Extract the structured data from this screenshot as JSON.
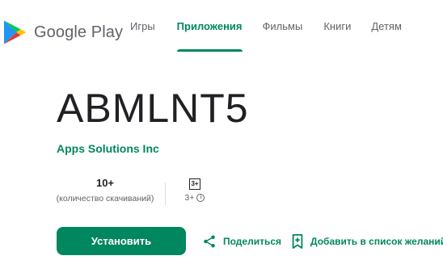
{
  "header": {
    "logo_text": "Google Play",
    "nav": [
      {
        "label": "Игры",
        "active": false
      },
      {
        "label": "Приложения",
        "active": true
      },
      {
        "label": "Фильмы",
        "active": false
      },
      {
        "label": "Книги",
        "active": false
      },
      {
        "label": "Детям",
        "active": false
      }
    ]
  },
  "app": {
    "title": "ABMLNT5",
    "developer": "Apps Solutions Inc",
    "stats": {
      "downloads_value": "10+",
      "downloads_label": "(количество скачиваний)",
      "rating_badge": "3+",
      "rating_label": "3+"
    }
  },
  "actions": {
    "install_label": "Установить",
    "share_label": "Поделиться",
    "wishlist_label": "Добавить в список желаний"
  },
  "colors": {
    "accent": "#01875f",
    "text_primary": "#202124",
    "text_secondary": "#5f6368"
  },
  "icons": {
    "logo": "google-play-logo",
    "info": "info-icon",
    "share": "share-icon",
    "wishlist": "bookmark-add-icon"
  }
}
